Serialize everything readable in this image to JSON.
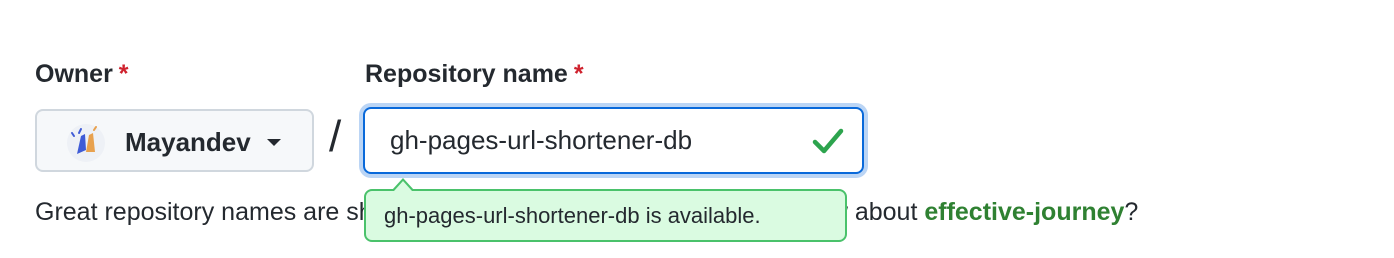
{
  "owner": {
    "label": "Owner",
    "required_mark": "*",
    "selected": "Mayandev",
    "avatar_icon": "clapping-hands-avatar",
    "dropdown_icon": "caret-down-icon"
  },
  "separator": "/",
  "repository": {
    "label": "Repository name",
    "required_mark": "*",
    "value": "gh-pages-url-shortener-db",
    "status_icon": "check-icon"
  },
  "tooltip": {
    "text": "gh-pages-url-shortener-db is available."
  },
  "hint": {
    "prefix": "Great repository names are short and memorable. Need inspiration? How about ",
    "suggestion": "effective-journey",
    "suffix": "?"
  },
  "colors": {
    "required": "#cf222e",
    "focus_border": "#0969da",
    "success": "#2da44e",
    "tooltip_bg": "#dafbe1",
    "tooltip_border": "#4ac26b",
    "suggestion": "#2f8132"
  }
}
